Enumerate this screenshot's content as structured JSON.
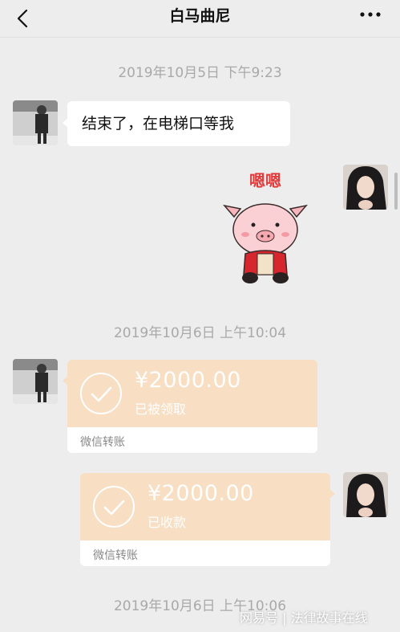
{
  "header": {
    "title": "白马曲尼"
  },
  "messages": [
    {
      "timestamp": "2019年10月5日 下午9:23",
      "text": "结束了，在电梯口等我"
    },
    {
      "sticker_text": "嗯嗯"
    },
    {
      "timestamp": "2019年10月6日 上午10:04"
    },
    {
      "amount": "¥2000.00",
      "status": "已被领取",
      "label": "微信转账"
    },
    {
      "amount": "¥2000.00",
      "status": "已收款",
      "label": "微信转账"
    },
    {
      "timestamp": "2019年10月6日 上午10:06"
    }
  ],
  "watermark": "网易号 | 法律故事在线",
  "colors": {
    "background": "#ededed",
    "transfer": "#f8dec2",
    "text": "#111111",
    "timestamp": "#a9a9a9"
  }
}
